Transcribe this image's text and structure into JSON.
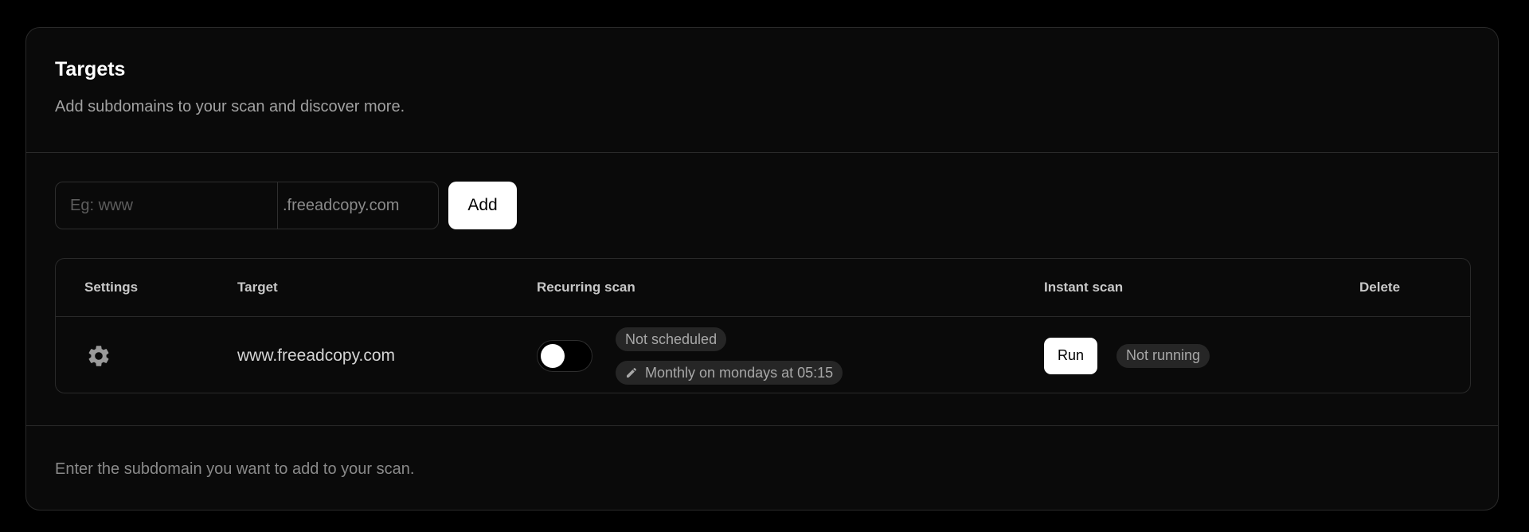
{
  "header": {
    "title": "Targets",
    "description": "Add subdomains to your scan and discover more."
  },
  "add_form": {
    "placeholder": "Eg: www",
    "value": "",
    "suffix": ".freeadcopy.com",
    "add_label": "Add"
  },
  "table": {
    "columns": {
      "settings": "Settings",
      "target": "Target",
      "recurring": "Recurring scan",
      "instant": "Instant scan",
      "delete": "Delete"
    },
    "rows": [
      {
        "settings_icon": "gear-icon",
        "target": "www.freeadcopy.com",
        "recurring_enabled": false,
        "schedule_status": "Not scheduled",
        "schedule_text": "Monthly on mondays at 05:15",
        "schedule_icon": "pencil-icon",
        "run_label": "Run",
        "run_status": "Not running"
      }
    ]
  },
  "footer": {
    "hint": "Enter the subdomain you want to add to your scan."
  },
  "colors": {
    "background": "#000000",
    "card": "#0a0a0a",
    "border": "#2a2a2a",
    "badge": "#262626",
    "button": "#ffffff"
  }
}
